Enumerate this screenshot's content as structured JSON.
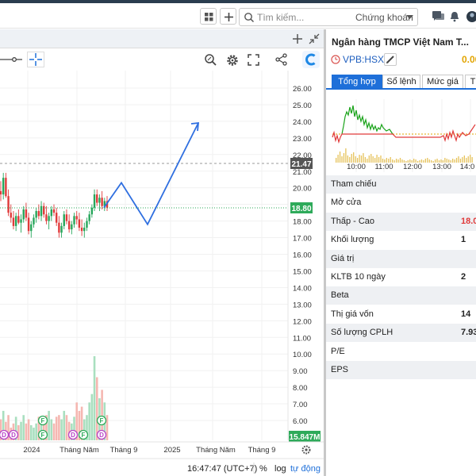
{
  "header": {
    "search_placeholder": "Tìm kiếm...",
    "search_scope": "Chứng khoán"
  },
  "chart": {
    "x_labels": [
      "2024",
      "Tháng Năm",
      "Tháng 9",
      "2025",
      "Tháng Năm",
      "Tháng 9"
    ],
    "y_labels": [
      "26.00",
      "25.00",
      "24.00",
      "23.00",
      "22.00",
      "21.00",
      "20.00",
      "19.00",
      "18.00",
      "17.00",
      "16.00",
      "15.00",
      "14.00",
      "13.00",
      "12.00",
      "11.00",
      "10.00",
      "9.00",
      "8.00",
      "7.00",
      "6.00"
    ],
    "ref_price_badge": "21.47",
    "last_price_badge": "18.80",
    "volume_badge": "15.847M",
    "event_markers": [
      "D",
      "D",
      "F",
      "F",
      "D",
      "F",
      "F",
      "D"
    ],
    "time_display": "16:47:47 (UTC+7)",
    "percent_label": "%",
    "log_label": "log",
    "auto_label": "tự động"
  },
  "chart_data": {
    "type": "candlestick",
    "ylim": [
      5.5,
      26.5
    ],
    "price_lines": {
      "reference": 21.47,
      "last": 18.8
    },
    "projection_path_y": [
      18.8,
      20.3,
      17.8,
      23.9
    ],
    "candles_ohlc": [
      [
        19.8,
        20.4,
        19.2,
        19.6
      ],
      [
        19.6,
        20.9,
        19.3,
        20.6
      ],
      [
        20.6,
        20.9,
        19.4,
        19.5
      ],
      [
        19.5,
        19.9,
        18.3,
        18.5
      ],
      [
        18.5,
        19.0,
        17.9,
        18.2
      ],
      [
        18.2,
        18.6,
        17.5,
        17.7
      ],
      [
        17.7,
        18.5,
        17.4,
        18.3
      ],
      [
        18.3,
        18.7,
        17.8,
        17.9
      ],
      [
        17.9,
        18.4,
        17.3,
        18.1
      ],
      [
        18.1,
        18.9,
        17.9,
        18.7
      ],
      [
        18.7,
        19.1,
        18.0,
        18.2
      ],
      [
        18.2,
        18.5,
        17.2,
        17.4
      ],
      [
        17.4,
        18.0,
        17.0,
        17.8
      ],
      [
        17.8,
        18.4,
        17.6,
        18.2
      ],
      [
        18.2,
        18.8,
        17.9,
        18.6
      ],
      [
        18.6,
        19.0,
        18.1,
        18.3
      ],
      [
        18.3,
        19.2,
        18.0,
        18.9
      ],
      [
        18.9,
        19.1,
        18.2,
        18.4
      ],
      [
        18.4,
        18.9,
        17.8,
        18.0
      ],
      [
        18.0,
        18.5,
        17.5,
        18.3
      ],
      [
        18.3,
        18.9,
        18.0,
        18.7
      ],
      [
        18.7,
        19.0,
        18.3,
        18.5
      ],
      [
        18.5,
        18.8,
        17.7,
        17.9
      ],
      [
        17.9,
        18.3,
        17.0,
        17.3
      ],
      [
        17.3,
        17.9,
        17.0,
        17.7
      ],
      [
        17.7,
        18.6,
        17.5,
        18.4
      ],
      [
        18.4,
        18.7,
        17.8,
        18.0
      ],
      [
        18.0,
        18.4,
        17.3,
        17.5
      ],
      [
        17.5,
        18.0,
        17.2,
        17.8
      ],
      [
        17.8,
        18.5,
        17.6,
        18.3
      ],
      [
        18.3,
        18.6,
        17.8,
        18.1
      ],
      [
        18.1,
        18.5,
        17.4,
        17.6
      ],
      [
        17.6,
        18.1,
        17.1,
        17.4
      ],
      [
        17.4,
        17.9,
        17.0,
        17.6
      ],
      [
        17.6,
        18.2,
        17.4,
        18.0
      ],
      [
        18.0,
        18.6,
        17.8,
        18.4
      ],
      [
        18.4,
        19.0,
        18.2,
        18.8
      ],
      [
        18.8,
        19.9,
        18.6,
        19.6
      ],
      [
        19.6,
        19.9,
        18.9,
        19.1
      ],
      [
        19.1,
        19.6,
        18.6,
        19.4
      ],
      [
        19.4,
        19.8,
        18.7,
        18.9
      ],
      [
        18.9,
        19.4,
        18.6,
        19.2
      ],
      [
        19.2,
        19.5,
        18.6,
        18.8
      ]
    ],
    "volume_relative": [
      0.25,
      0.35,
      0.22,
      0.3,
      0.15,
      0.2,
      0.28,
      0.18,
      0.22,
      0.3,
      0.2,
      0.25,
      0.18,
      0.15,
      0.2,
      0.28,
      0.2,
      0.22,
      0.3,
      0.35,
      0.25,
      0.2,
      0.28,
      0.3,
      0.25,
      0.35,
      0.3,
      0.22,
      0.2,
      0.28,
      0.45,
      0.35,
      0.4,
      0.25,
      0.3,
      0.45,
      0.55,
      1.0,
      0.75,
      0.5,
      0.6,
      0.45,
      0.3
    ]
  },
  "mini_chart": {
    "x_labels": [
      "10:00",
      "11:00",
      "12:00",
      "13:00",
      "14:0"
    ]
  },
  "info": {
    "title": "Ngân hàng TMCP Việt Nam T...",
    "ticker": "VPB:HSX",
    "price_change": "0.00",
    "tabs": [
      "Tổng hợp",
      "Sổ lệnh",
      "Mức giá",
      "T"
    ],
    "rows": [
      {
        "label": "Tham chiếu",
        "value": ""
      },
      {
        "label": "Mở cửa",
        "value": ""
      },
      {
        "label": "Thấp - Cao",
        "value": "18.0"
      },
      {
        "label": "Khối lượng",
        "value": "1"
      },
      {
        "label": "Giá trị",
        "value": ""
      },
      {
        "label": "KLTB 10 ngày",
        "value": "2"
      },
      {
        "label": "Beta",
        "value": ""
      },
      {
        "label": "Thị giá vốn",
        "value": "14"
      },
      {
        "label": "Số lượng CPLH",
        "value": "7.93"
      },
      {
        "label": "P/E",
        "value": ""
      },
      {
        "label": "EPS",
        "value": ""
      }
    ]
  }
}
